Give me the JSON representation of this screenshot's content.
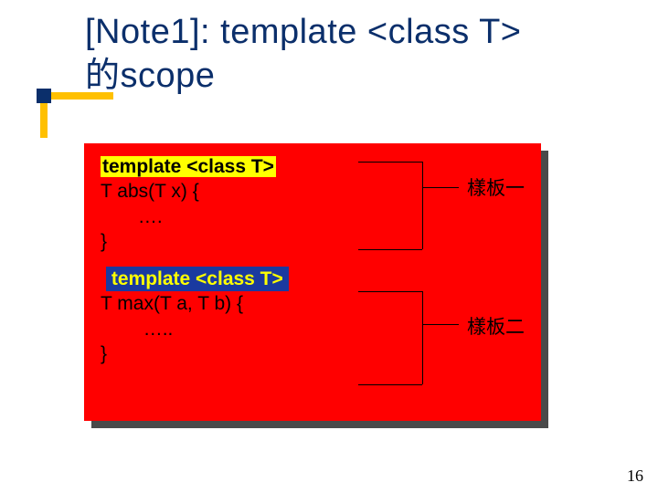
{
  "title_line1": "[Note1]: template <class T>",
  "title_line2": "的scope",
  "code": {
    "block1": {
      "decl": "template <class T>",
      "sig": "T abs(T x) {",
      "dots": "….",
      "close": "}"
    },
    "block2": {
      "decl": "template <class T>",
      "sig": "T max(T a, T b) {",
      "dots": "…..",
      "close": "}"
    }
  },
  "labels": {
    "one": "樣板一",
    "two": "樣板二"
  },
  "page_number": "16"
}
